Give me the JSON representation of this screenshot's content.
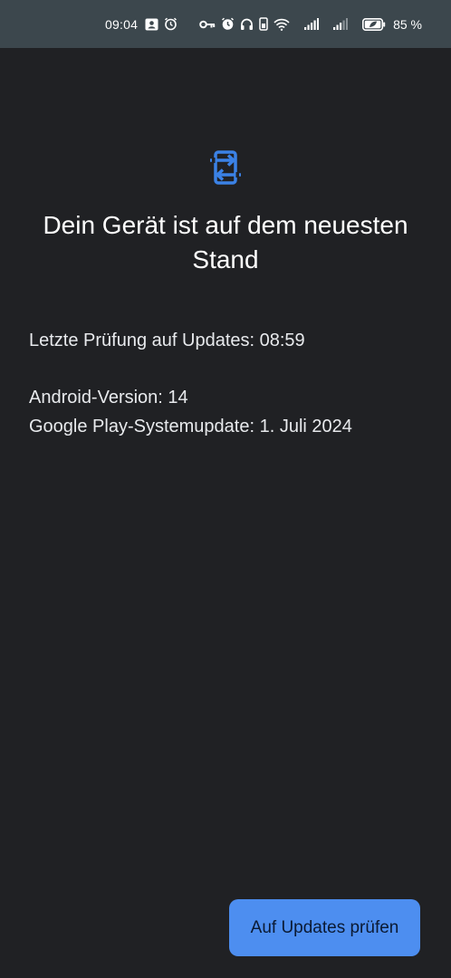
{
  "status_bar": {
    "time": "09:04",
    "battery_percent": "85 %",
    "icons": [
      "contact-card-icon",
      "alarm-icon",
      "vpn-key-icon",
      "alarm-icon",
      "headphones-icon",
      "battery-saver-phone-icon",
      "wifi-icon",
      "signal-icon",
      "signal-icon",
      "battery-icon"
    ]
  },
  "main": {
    "icon": "system-update-icon",
    "title": "Dein Gerät ist auf dem neuesten Stand",
    "last_check": "Letzte Prüfung auf Updates: 08:59",
    "android_version": "Android-Version: 14",
    "google_play_update": "Google Play-Systemupdate: 1. Juli 2024"
  },
  "actions": {
    "check_updates_label": "Auf Updates prüfen"
  },
  "colors": {
    "background": "#202124",
    "status_bar": "#3c474d",
    "accent": "#4d8ef0",
    "icon_blue": "#3b82e6"
  }
}
